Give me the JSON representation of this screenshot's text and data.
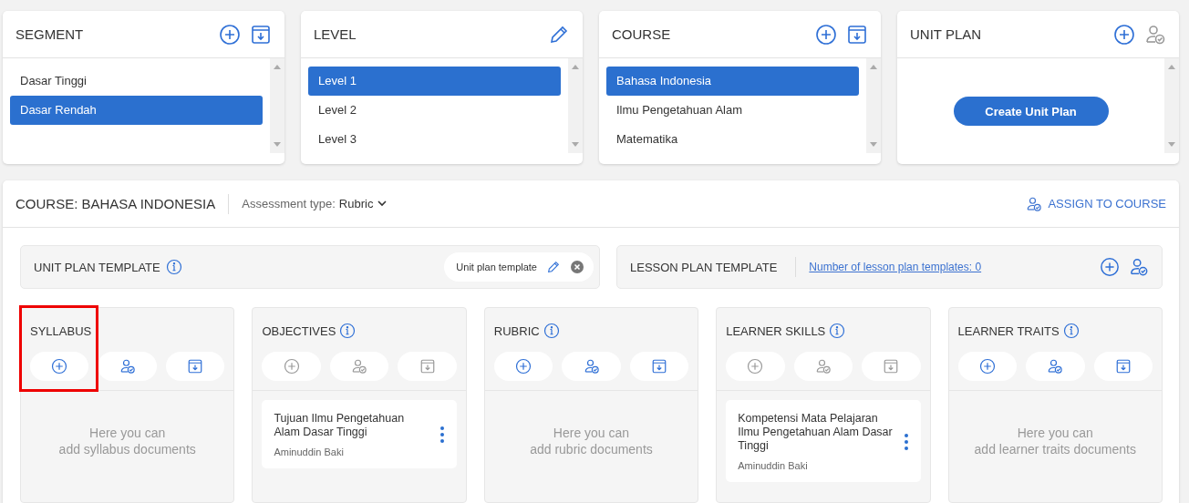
{
  "top_panels": [
    {
      "title": "SEGMENT",
      "actions": [
        {
          "kind": "add",
          "disabled": false
        },
        {
          "kind": "archive",
          "disabled": false
        }
      ],
      "items": [
        {
          "label": "Dasar Tinggi",
          "selected": false
        },
        {
          "label": "Dasar Rendah",
          "selected": true
        }
      ]
    },
    {
      "title": "LEVEL",
      "actions": [
        {
          "kind": "edit",
          "disabled": false
        }
      ],
      "items": [
        {
          "label": "Level 1",
          "selected": true
        },
        {
          "label": "Level 2",
          "selected": false
        },
        {
          "label": "Level 3",
          "selected": false
        }
      ]
    },
    {
      "title": "COURSE",
      "actions": [
        {
          "kind": "add",
          "disabled": false
        },
        {
          "kind": "archive",
          "disabled": false
        }
      ],
      "items": [
        {
          "label": "Bahasa Indonesia",
          "selected": true
        },
        {
          "label": "Ilmu Pengetahuan Alam",
          "selected": false
        },
        {
          "label": "Matematika",
          "selected": false
        }
      ]
    },
    {
      "title": "UNIT PLAN",
      "actions": [
        {
          "kind": "add",
          "disabled": false
        },
        {
          "kind": "assign",
          "disabled": true
        }
      ],
      "button": "Create Unit Plan"
    }
  ],
  "course_header": {
    "title": "COURSE: BAHASA INDONESIA",
    "assessment_label": "Assessment type:",
    "assessment_value": "Rubric",
    "assign_link": "ASSIGN TO COURSE"
  },
  "unit_plan_template": {
    "title": "UNIT PLAN TEMPLATE",
    "chip": "Unit plan template"
  },
  "lesson_plan_template": {
    "title": "LESSON PLAN TEMPLATE",
    "link": "Number of lesson plan templates: 0",
    "actions": [
      {
        "kind": "add",
        "disabled": false
      },
      {
        "kind": "assign",
        "disabled": false
      }
    ]
  },
  "columns": [
    {
      "title": "SYLLABUS",
      "info": false,
      "highlighted": true,
      "actions": [
        {
          "kind": "add",
          "disabled": false
        },
        {
          "kind": "assign",
          "disabled": false
        },
        {
          "kind": "archive",
          "disabled": false
        }
      ],
      "empty_text": "Here you can\nadd syllabus documents"
    },
    {
      "title": "OBJECTIVES",
      "info": true,
      "highlighted": false,
      "actions": [
        {
          "kind": "add",
          "disabled": true
        },
        {
          "kind": "assign",
          "disabled": true
        },
        {
          "kind": "archive",
          "disabled": true
        }
      ],
      "documents": [
        {
          "title": "Tujuan Ilmu Pengetahuan Alam Dasar Tinggi",
          "author": "Aminuddin Baki"
        }
      ]
    },
    {
      "title": "RUBRIC",
      "info": true,
      "highlighted": false,
      "actions": [
        {
          "kind": "add",
          "disabled": false
        },
        {
          "kind": "assign",
          "disabled": false
        },
        {
          "kind": "archive",
          "disabled": false
        }
      ],
      "empty_text": "Here you can\nadd rubric documents"
    },
    {
      "title": "LEARNER SKILLS",
      "info": true,
      "highlighted": false,
      "actions": [
        {
          "kind": "add",
          "disabled": true
        },
        {
          "kind": "assign",
          "disabled": true
        },
        {
          "kind": "archive",
          "disabled": true
        }
      ],
      "documents": [
        {
          "title": "Kompetensi Mata Pelajaran Ilmu Pengetahuan Alam Dasar Tinggi",
          "author": "Aminuddin Baki"
        }
      ]
    },
    {
      "title": "LEARNER TRAITS",
      "info": true,
      "highlighted": false,
      "actions": [
        {
          "kind": "add",
          "disabled": false
        },
        {
          "kind": "assign",
          "disabled": false
        },
        {
          "kind": "archive",
          "disabled": false
        }
      ],
      "empty_text": "Here you can\nadd learner traits documents"
    }
  ]
}
